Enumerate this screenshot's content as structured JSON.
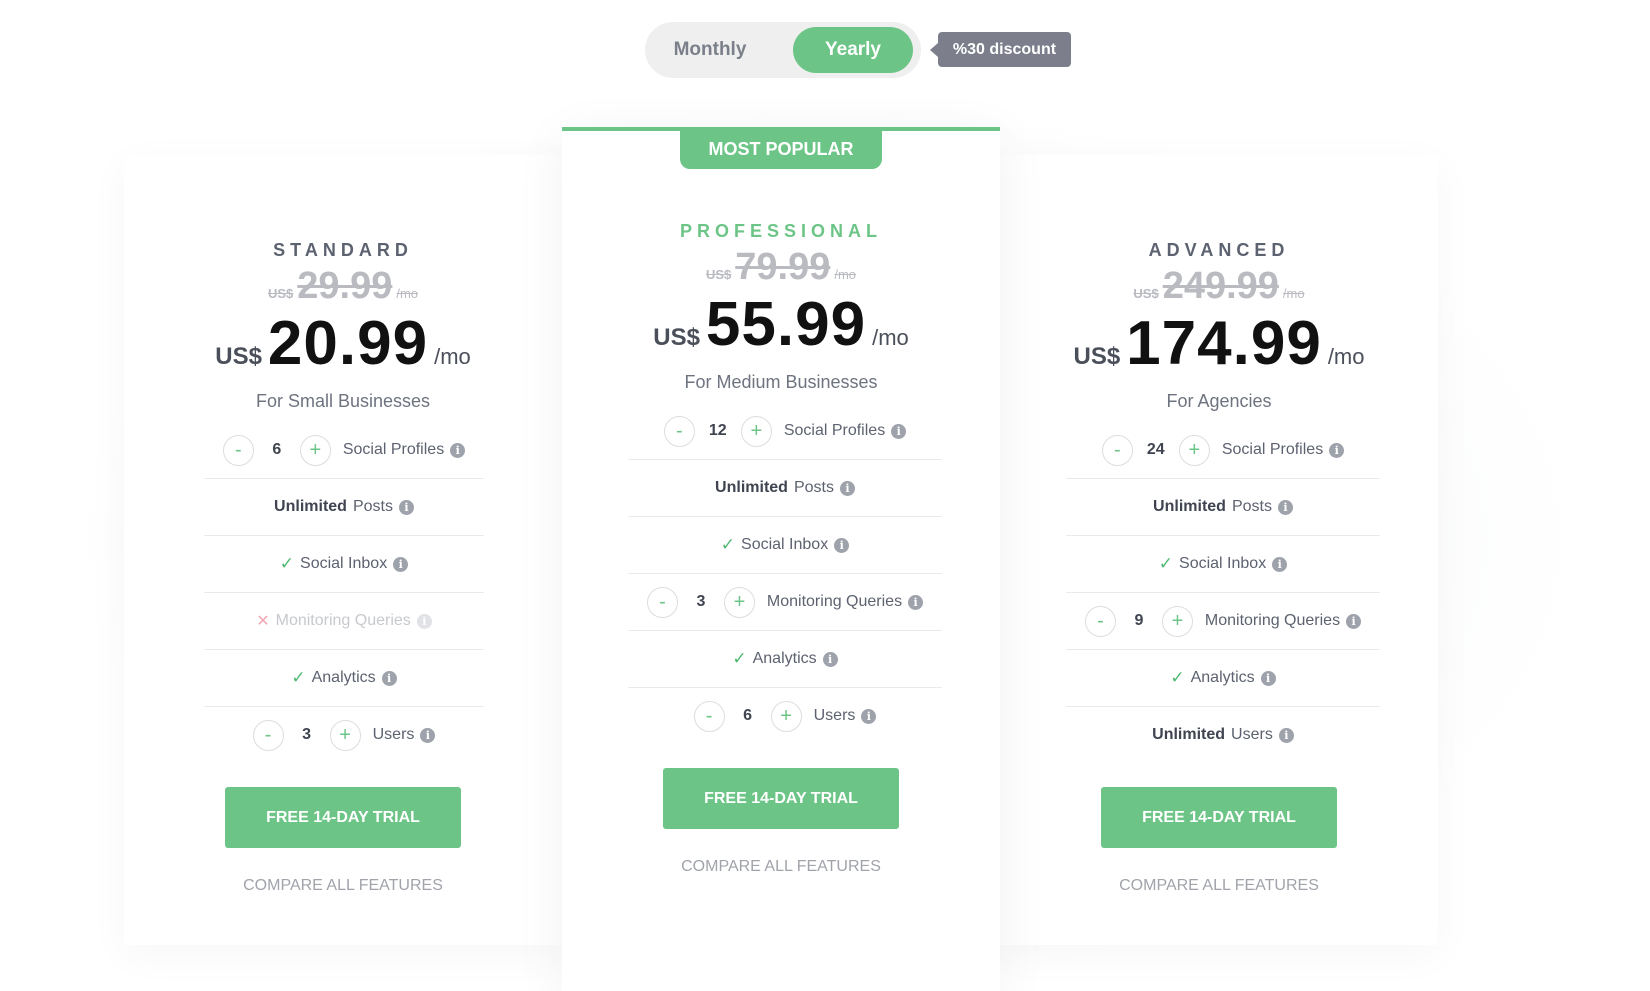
{
  "billing": {
    "monthly_label": "Monthly",
    "yearly_label": "Yearly",
    "selected": "Yearly",
    "discount_label": "%30 discount"
  },
  "colors": {
    "accent": "#6cc587",
    "discount_badge": "#7c7f8b",
    "text": "#4a4f5a",
    "price": "#111111"
  },
  "plans": [
    {
      "name": "STANDARD",
      "old_currency": "US$",
      "old_price": "29.99",
      "old_period": "/mo",
      "currency": "US$",
      "price": "20.99",
      "period": "/mo",
      "tagline": "For Small Businesses",
      "features": [
        {
          "type": "stepper",
          "value": "6",
          "label": "Social Profiles"
        },
        {
          "type": "text",
          "strong": "Unlimited",
          "label": "Posts"
        },
        {
          "type": "check",
          "label": "Social Inbox"
        },
        {
          "type": "cross",
          "label": "Monitoring Queries"
        },
        {
          "type": "check",
          "label": "Analytics"
        },
        {
          "type": "stepper",
          "value": "3",
          "label": "Users"
        }
      ],
      "cta": "FREE 14-DAY TRIAL",
      "compare": "COMPARE ALL FEATURES"
    },
    {
      "badge": "MOST POPULAR",
      "name": "PROFESSIONAL",
      "old_currency": "US$",
      "old_price": "79.99",
      "old_period": "/mo",
      "currency": "US$",
      "price": "55.99",
      "period": "/mo",
      "tagline": "For Medium Businesses",
      "features": [
        {
          "type": "stepper",
          "value": "12",
          "label": "Social Profiles"
        },
        {
          "type": "text",
          "strong": "Unlimited",
          "label": "Posts"
        },
        {
          "type": "check",
          "label": "Social Inbox"
        },
        {
          "type": "stepper",
          "value": "3",
          "label": "Monitoring Queries"
        },
        {
          "type": "check",
          "label": "Analytics"
        },
        {
          "type": "stepper",
          "value": "6",
          "label": "Users"
        }
      ],
      "cta": "FREE 14-DAY TRIAL",
      "compare": "COMPARE ALL FEATURES"
    },
    {
      "name": "ADVANCED",
      "old_currency": "US$",
      "old_price": "249.99",
      "old_period": "/mo",
      "currency": "US$",
      "price": "174.99",
      "period": "/mo",
      "tagline": "For Agencies",
      "features": [
        {
          "type": "stepper",
          "value": "24",
          "label": "Social Profiles"
        },
        {
          "type": "text",
          "strong": "Unlimited",
          "label": "Posts"
        },
        {
          "type": "check",
          "label": "Social Inbox"
        },
        {
          "type": "stepper",
          "value": "9",
          "label": "Monitoring Queries"
        },
        {
          "type": "check",
          "label": "Analytics"
        },
        {
          "type": "text",
          "strong": "Unlimited",
          "label": "Users"
        }
      ],
      "cta": "FREE 14-DAY TRIAL",
      "compare": "COMPARE ALL FEATURES"
    }
  ],
  "symbols": {
    "minus": "-",
    "plus": "+",
    "check": "✓",
    "cross": "✕",
    "info": "i"
  }
}
